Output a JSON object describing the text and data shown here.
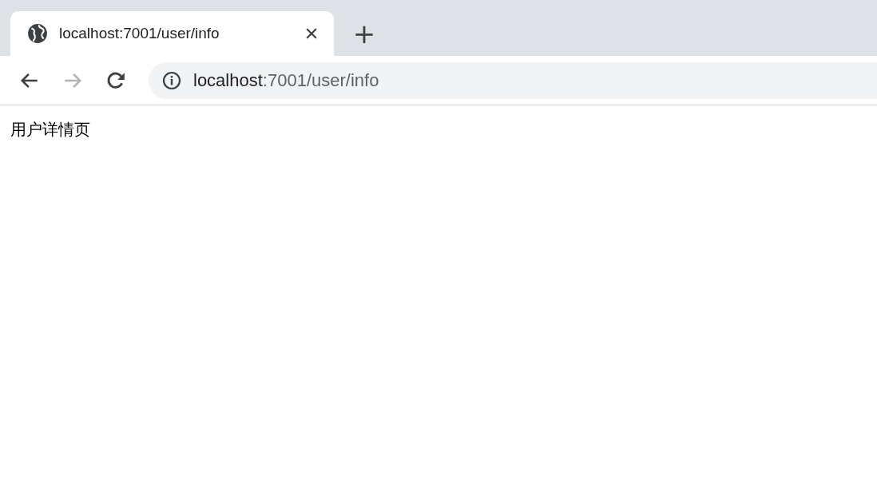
{
  "tabs": [
    {
      "title": "localhost:7001/user/info",
      "selected": true
    }
  ],
  "new_tab_label": "+",
  "nav_buttons": [
    {
      "kind": "back",
      "disabled": false
    },
    {
      "kind": "forward",
      "disabled": true
    },
    {
      "kind": "reload",
      "disabled": false
    }
  ],
  "address": {
    "host": "localhost",
    "rest": ":7001/user/info"
  },
  "page": {
    "text": "用户详情页"
  }
}
